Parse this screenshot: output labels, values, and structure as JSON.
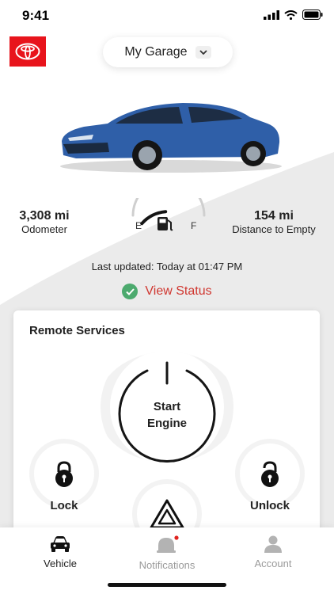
{
  "status_bar": {
    "time": "9:41"
  },
  "header": {
    "garage_label": "My Garage"
  },
  "stats": {
    "odometer_value": "3,308 mi",
    "odometer_label": "Odometer",
    "distance_value": "154 mi",
    "distance_label": "Distance to Empty",
    "gauge_empty_label": "E",
    "gauge_full_label": "F",
    "fuel_level_fraction": 0.45
  },
  "status": {
    "last_updated": "Last updated:  Today at 01:47 PM",
    "view_status_label": "View Status"
  },
  "remote": {
    "title": "Remote Services",
    "start_line1": "Start",
    "start_line2": "Engine",
    "lock_label": "Lock",
    "unlock_label": "Unlock"
  },
  "tabs": [
    {
      "label": "Vehicle",
      "icon": "car-icon",
      "active": true
    },
    {
      "label": "Notifications",
      "icon": "bell-icon",
      "active": false,
      "has_dot": true
    },
    {
      "label": "Account",
      "icon": "person-icon",
      "active": false
    }
  ],
  "colors": {
    "brand_red": "#e8141c",
    "status_green": "#4caa6e",
    "link_red": "#d0362f",
    "background_grey": "#ebebeb",
    "car_blue": "#2f5fa8"
  }
}
